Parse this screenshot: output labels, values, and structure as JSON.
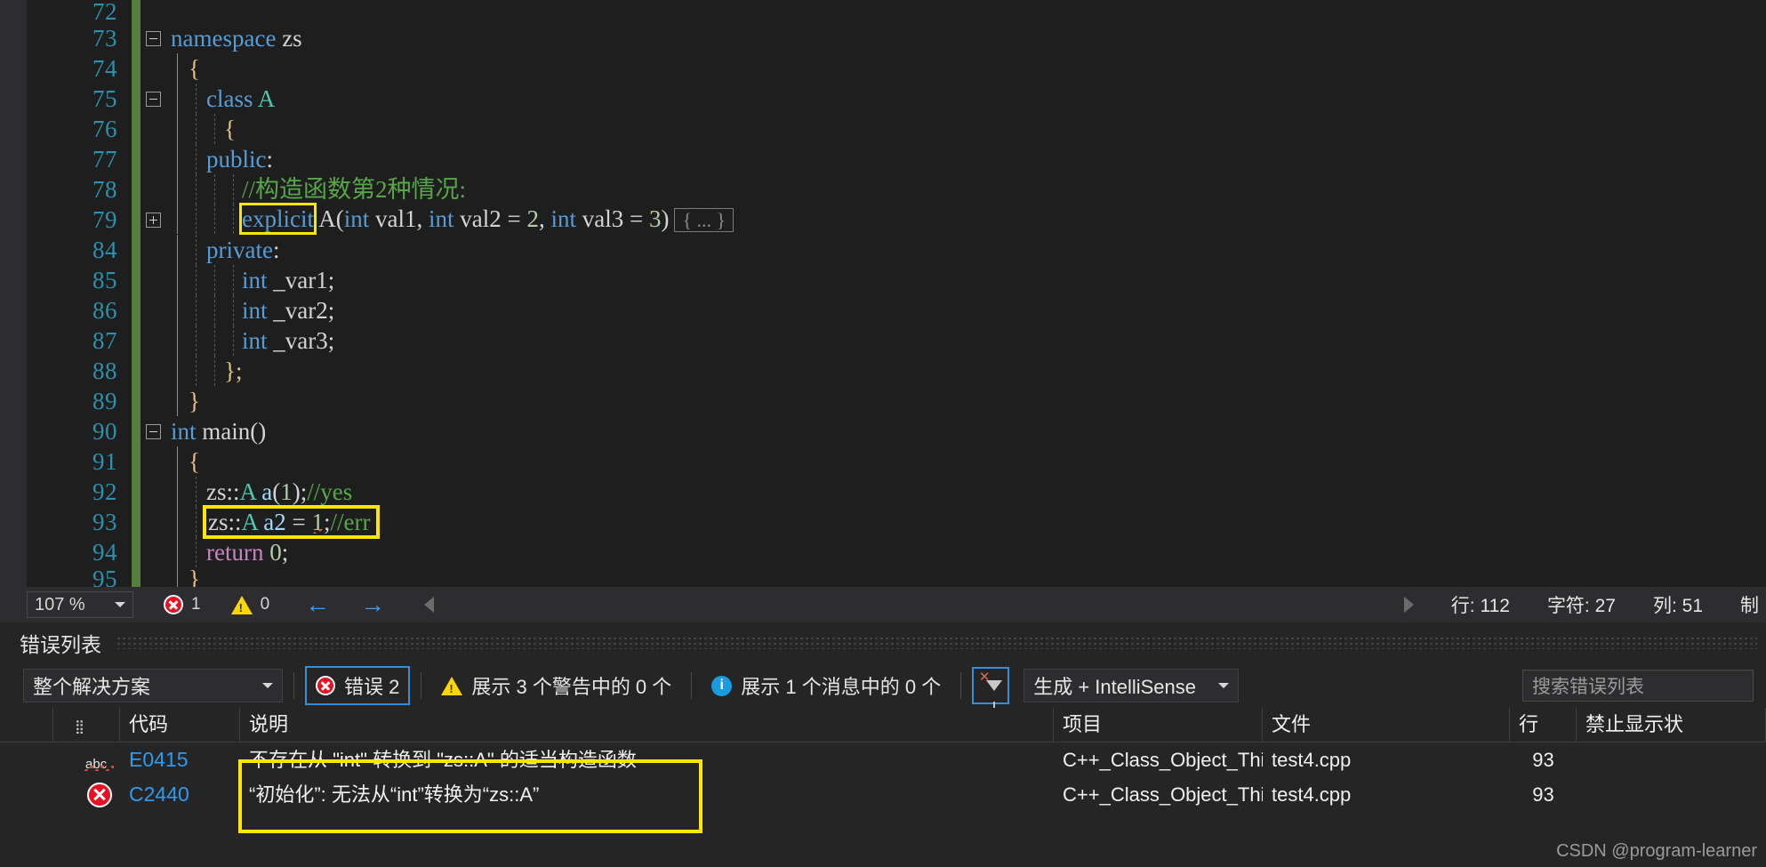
{
  "editor": {
    "lines": [
      {
        "no": "72",
        "partial": true,
        "tokens": []
      },
      {
        "no": "73",
        "fold": "minus",
        "indent": 0,
        "tokens": [
          {
            "t": "namespace ",
            "c": "kw"
          },
          {
            "t": "zs",
            "c": "id"
          }
        ]
      },
      {
        "no": "74",
        "indent": 1,
        "tokens": [
          {
            "t": "{",
            "c": "brace"
          }
        ]
      },
      {
        "no": "75",
        "fold": "minus",
        "indent": 2,
        "tokens": [
          {
            "t": "class ",
            "c": "kw"
          },
          {
            "t": "A",
            "c": "cls"
          }
        ]
      },
      {
        "no": "76",
        "indent": 3,
        "tokens": [
          {
            "t": "{",
            "c": "brace"
          }
        ]
      },
      {
        "no": "77",
        "indent": 2,
        "tokens": [
          {
            "t": "public",
            "c": "kw"
          },
          {
            "t": ":",
            "c": "punct"
          }
        ]
      },
      {
        "no": "78",
        "indent": 4,
        "tokens": [
          {
            "t": "//构造函数第2种情况:",
            "c": "cmt"
          }
        ]
      },
      {
        "no": "79",
        "fold": "plus",
        "indent": 4,
        "highlight": "explicit",
        "tokens": [
          {
            "t": "explicit",
            "c": "kw"
          },
          {
            "t": " A",
            "c": "id"
          },
          {
            "t": "(",
            "c": "punct"
          },
          {
            "t": "int",
            "c": "type"
          },
          {
            "t": " val1, ",
            "c": "id"
          },
          {
            "t": "int",
            "c": "type"
          },
          {
            "t": " val2 = ",
            "c": "id"
          },
          {
            "t": "2",
            "c": "num"
          },
          {
            "t": ", ",
            "c": "id"
          },
          {
            "t": "int",
            "c": "type"
          },
          {
            "t": " val3 = ",
            "c": "id"
          },
          {
            "t": "3",
            "c": "num"
          },
          {
            "t": ")",
            "c": "punct"
          }
        ],
        "collapsed": "{ ... }"
      },
      {
        "no": "84",
        "indent": 2,
        "tokens": [
          {
            "t": "private",
            "c": "kw"
          },
          {
            "t": ":",
            "c": "punct"
          }
        ]
      },
      {
        "no": "85",
        "indent": 4,
        "tokens": [
          {
            "t": "int",
            "c": "type"
          },
          {
            "t": " _var1;",
            "c": "id"
          }
        ]
      },
      {
        "no": "86",
        "indent": 4,
        "tokens": [
          {
            "t": "int",
            "c": "type"
          },
          {
            "t": " _var2;",
            "c": "id"
          }
        ]
      },
      {
        "no": "87",
        "indent": 4,
        "tokens": [
          {
            "t": "int",
            "c": "type"
          },
          {
            "t": " _var3;",
            "c": "id"
          }
        ]
      },
      {
        "no": "88",
        "indent": 3,
        "tokens": [
          {
            "t": "};",
            "c": "brace"
          }
        ]
      },
      {
        "no": "89",
        "indent": 1,
        "tokens": [
          {
            "t": "}",
            "c": "brace"
          }
        ]
      },
      {
        "no": "90",
        "fold": "minus",
        "indent": 0,
        "tokens": [
          {
            "t": "int",
            "c": "type"
          },
          {
            "t": " ",
            "c": "id"
          },
          {
            "t": "main",
            "c": "id"
          },
          {
            "t": "()",
            "c": "punct"
          }
        ]
      },
      {
        "no": "91",
        "indent": 1,
        "tokens": [
          {
            "t": "{",
            "c": "brace"
          }
        ]
      },
      {
        "no": "92",
        "indent": 2,
        "tokens": [
          {
            "t": "zs",
            "c": "id"
          },
          {
            "t": "::",
            "c": "punct"
          },
          {
            "t": "A",
            "c": "cls"
          },
          {
            "t": " a",
            "c": "param"
          },
          {
            "t": "(",
            "c": "punct"
          },
          {
            "t": "1",
            "c": "num"
          },
          {
            "t": ")",
            "c": "punct"
          },
          {
            "t": ";",
            "c": "punct"
          },
          {
            "t": "//yes",
            "c": "cmt"
          }
        ]
      },
      {
        "no": "93",
        "indent": 2,
        "highlight": "row",
        "tokens": [
          {
            "t": "zs",
            "c": "id"
          },
          {
            "t": "::",
            "c": "punct"
          },
          {
            "t": "A",
            "c": "cls"
          },
          {
            "t": " a2",
            "c": "param"
          },
          {
            "t": " = ",
            "c": "punct"
          },
          {
            "t": "1",
            "c": "num"
          },
          {
            "t": ";",
            "c": "punct"
          },
          {
            "t": "//err",
            "c": "cmt"
          }
        ],
        "squiggle": true
      },
      {
        "no": "94",
        "indent": 2,
        "tokens": [
          {
            "t": "return",
            "c": "ret"
          },
          {
            "t": " ",
            "c": "id"
          },
          {
            "t": "0",
            "c": "num"
          },
          {
            "t": ";",
            "c": "punct"
          }
        ]
      },
      {
        "no": "95",
        "indent": 1,
        "partial": true,
        "tokens": [
          {
            "t": "}",
            "c": "brace"
          }
        ]
      }
    ]
  },
  "status_bar": {
    "zoom": "107 %",
    "error_count": "1",
    "warning_count": "0",
    "back_arrow": "←",
    "forward_arrow": "→",
    "line_label": "行: 112",
    "char_label": "字符: 27",
    "col_label": "列: 51",
    "mode_label": "制"
  },
  "error_panel": {
    "title": "错误列表",
    "scope_filter": "整个解决方案",
    "errors_button": "错误 2",
    "warnings_button": "展示 3 个警告中的 0 个",
    "messages_button": "展示 1 个消息中的 0 个",
    "build_filter": "生成 + IntelliSense",
    "search_placeholder": "搜索错误列表",
    "columns": [
      "",
      "",
      "代码",
      "说明",
      "项目",
      "文件",
      "行",
      "禁止显示状"
    ],
    "rows": [
      {
        "icon": "abc-squiggle-icon",
        "code": "E0415",
        "description": "不存在从 \"int\" 转换到 \"zs::A\" 的适当构造函数",
        "project": "C++_Class_Object_Third",
        "file": "test4.cpp",
        "line": "93",
        "suppression": ""
      },
      {
        "icon": "error-x-icon",
        "code": "C2440",
        "description": "“初始化”: 无法从“int”转换为“zs::A”",
        "project": "C++_Class_Object_Third",
        "file": "test4.cpp",
        "line": "93",
        "suppression": ""
      }
    ]
  },
  "watermark": "CSDN @program-learner",
  "colors": {
    "editor_bg": "#1e1e1e",
    "panel_bg": "#252526",
    "statusbar_bg": "#2d2d30",
    "keyword": "#569cd6",
    "class_name": "#4ec9b0",
    "comment": "#57a64a",
    "number": "#b5cea8",
    "linenum": "#2b91af",
    "highlight_box": "#ffe600",
    "error_red": "#e81123",
    "warning_yellow": "#ffd700",
    "accent_blue": "#2f9bf0",
    "changebar_green": "#55803b"
  }
}
